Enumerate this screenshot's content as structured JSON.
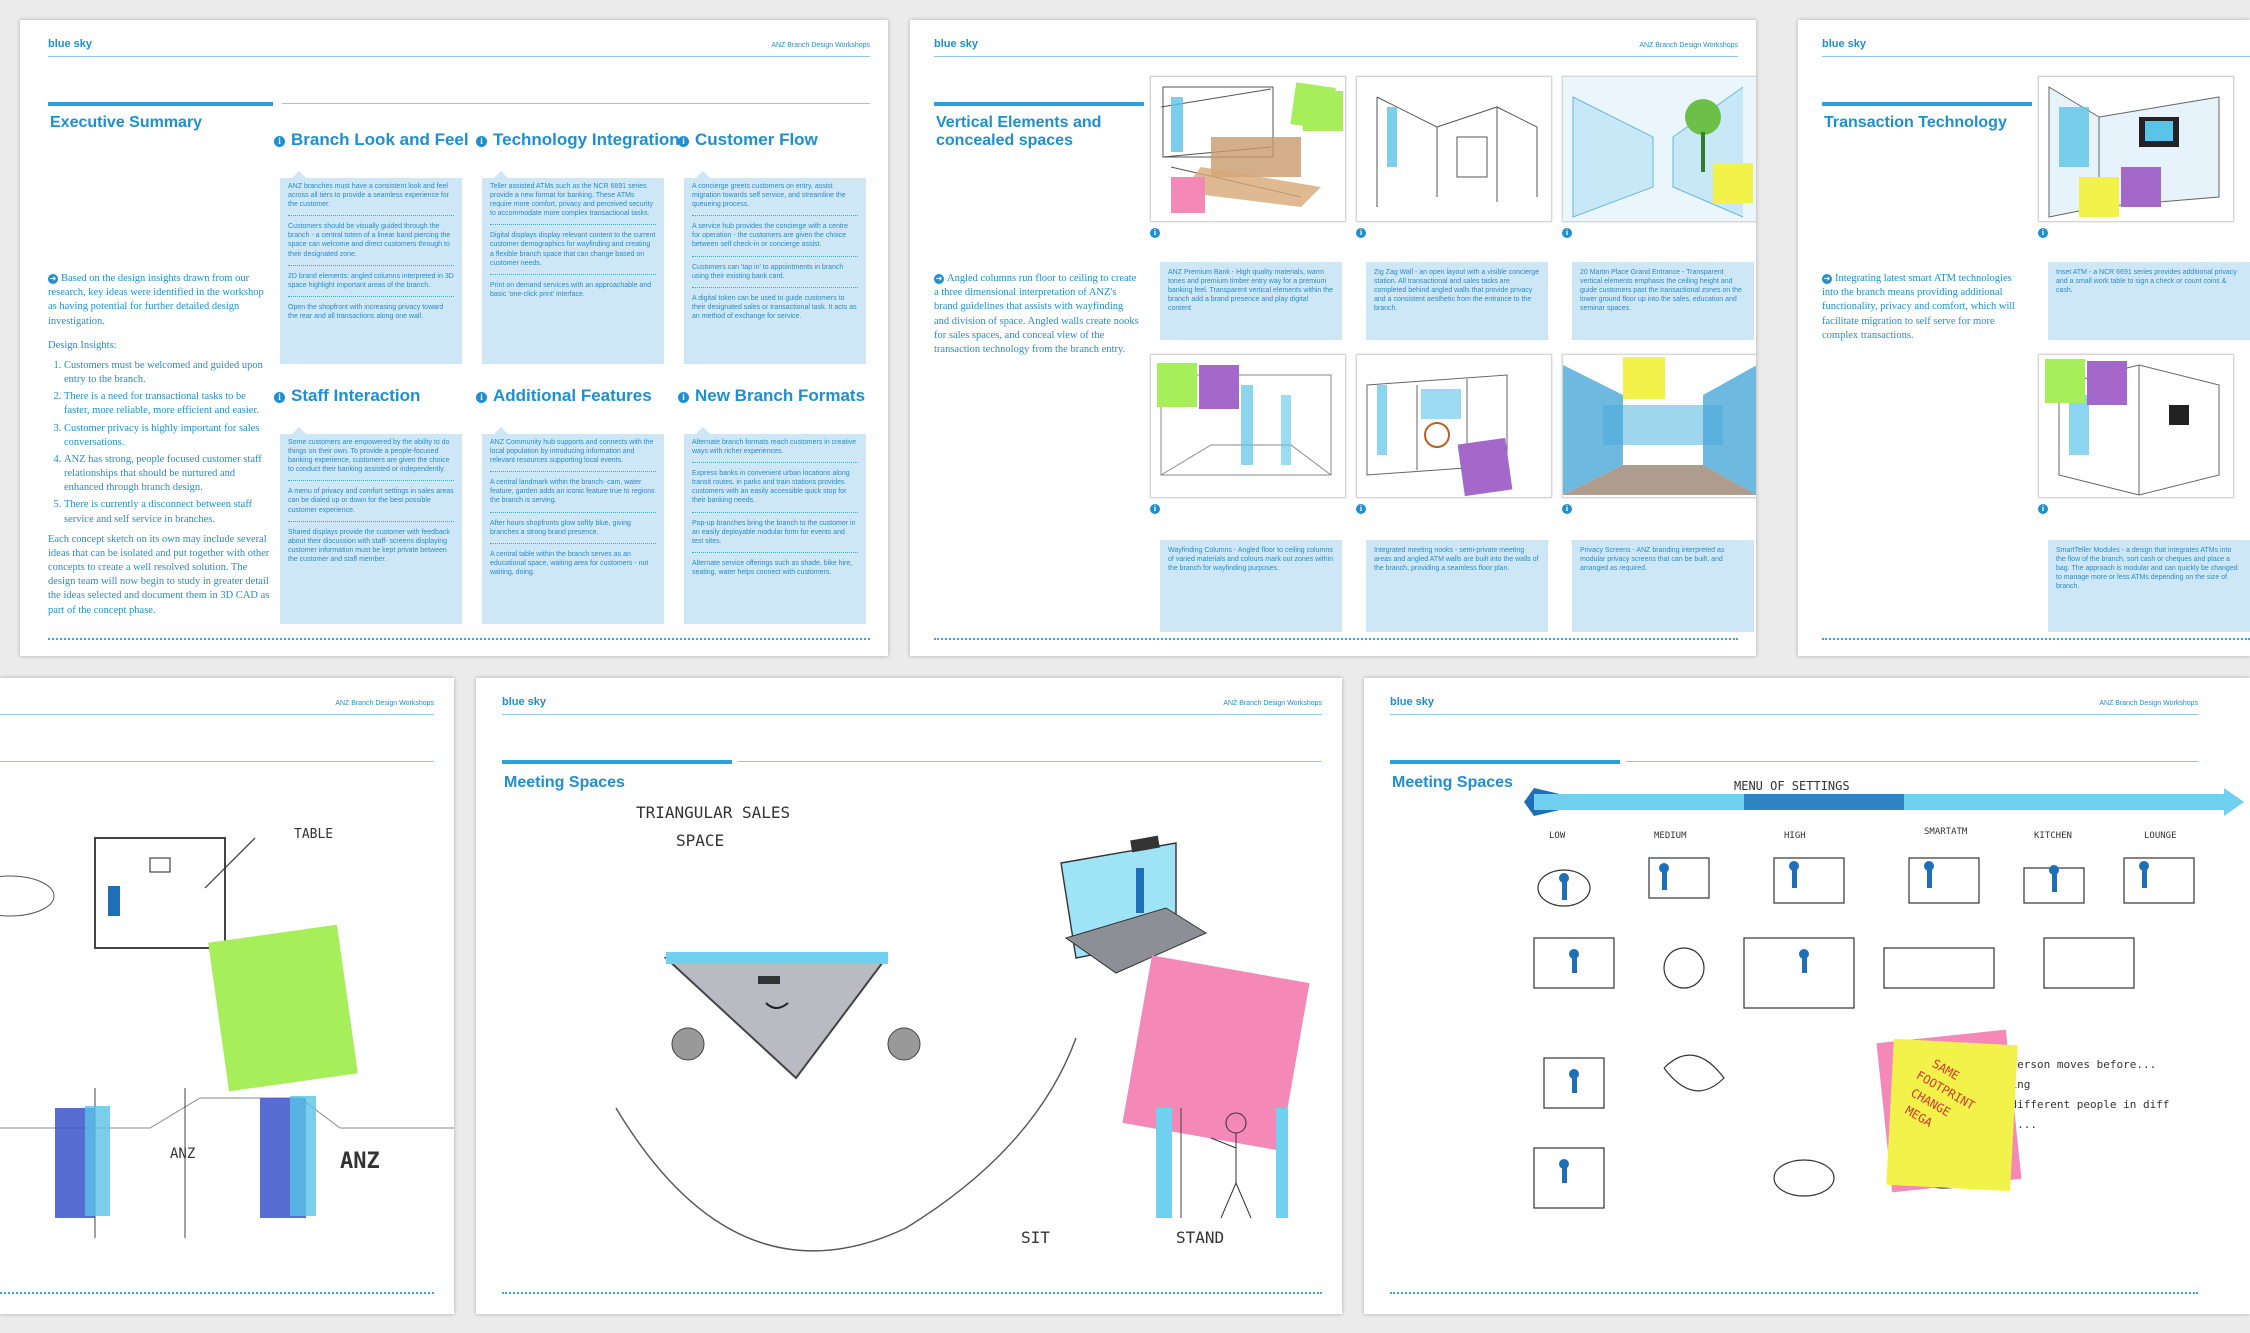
{
  "brand": "blue sky",
  "header_right": "ANZ Branch Design Workshops",
  "exec": {
    "title": "Executive Summary",
    "intro": "Based on the design insights drawn from our research, key ideas were identified in the workshop as having potential for further detailed design investigation.",
    "insights_label": "Design Insights:",
    "insights": [
      "Customers must be welcomed and guided upon entry to the branch.",
      "There is a need for transactional tasks to be faster, more reliable, more efficient and easier.",
      "Customer privacy is highly important for sales conversations.",
      "ANZ has strong, people focused customer staff relationships that should be nurtured and enhanced through branch design.",
      "There is currently a disconnect between staff service and self service in branches."
    ],
    "closing": "Each concept sketch on its own may include several ideas that can be isolated and put together with other concepts to create a well resolved solution. The design team will now begin to study in greater detail the ideas selected and document them in 3D CAD as part of the concept phase.",
    "columns": [
      {
        "heading": "Branch Look and Feel",
        "paras": [
          "ANZ branches must have a consistent look and feel across all tiers to provide a seamless experience for the customer.",
          "Customers should be visually guided through the branch - a central totem of a linear band piercing the space can welcome and direct customers through to their designated zone.",
          "2D brand elements: angled columns interpreted in 3D space highlight important areas of the branch.",
          "Open the shopfront with increasing privacy toward the rear and all transactions along one wall."
        ]
      },
      {
        "heading": "Technology Integration",
        "paras": [
          "Teller assisted ATMs such as the NCR 6691 series provide a new format for banking. These ATMs require more comfort, privacy and perceived security to accommodate more complex transactional tasks.",
          "Digital displays display relevant content to the current customer demographics for wayfinding and creating a flexible branch space that can change based on customer needs.",
          "Print on demand services with an approachable and basic 'one-click print' interface."
        ]
      },
      {
        "heading": "Customer Flow",
        "paras": [
          "A concierge greets customers on entry, assist migration towards self service, and streamline the queueing process.",
          "A service hub provides the concierge with a centre for operation - the customers are given the choice between self check-in or concierge assist.",
          "Customers can 'tap in' to appointments in branch using their existing bank card.",
          "A digital token can be used to guide customers to their designated sales or transactional task. It acts as an method of exchange for service."
        ]
      },
      {
        "heading": "Staff Interaction",
        "paras": [
          "Some customers are empowered by the ability to do things on their own. To provide a people-focused banking experience, customers are given the choice to conduct their banking assisted or independently.",
          "A menu of privacy and comfort settings in sales areas can be dialed up or down for the best possible customer experience.",
          "Shared displays provide the customer with feedback about their discussion with staff- screens displaying customer information must be kept private between the customer and staff member."
        ]
      },
      {
        "heading": "Additional Features",
        "paras": [
          "ANZ Community hub supports and connects with the local population by introducing information and relevant resources supporting local events.",
          "A central landmark within the branch- cam, water feature, garden adds an iconic feature true to regions the branch is serving.",
          "After hours shopfronts glow softly blue, giving branches a strong brand presence.",
          "A central table within the branch serves as an educational space, waiting area for customers - not waiting, doing."
        ]
      },
      {
        "heading": "New Branch Formats",
        "paras": [
          "Alternate branch formats reach customers in creative ways with richer experiences.",
          "Express banks in convenient urban locations along transit routes, in parks and train stations provides customers with an easily accessible quick stop for their banking needs.",
          "Pop-up branches bring the branch to the customer in an easily deployable modular form for events and test sites.",
          "Alternate service offerings such as shade, bike hire, seating, water helps connect with customers."
        ]
      }
    ]
  },
  "vertical": {
    "title": "Vertical Elements and concealed spaces",
    "intro": "Angled columns run floor to ceiling to create a three dimensional interpretation of ANZ's brand guidelines that assists with wayfinding and division of space. Angled walls create nooks for sales spaces, and conceal view of the transaction technology from the branch entry.",
    "captions": [
      "ANZ Premium Bank - High quality materials, warm tones and premium timber entry way for a premium banking feel. Transparent vertical elements within the branch add a brand presence and play digital content.",
      "Zig Zag Wall - an open layout with a visible concierge station. All transactional and sales tasks are completed behind angled walls that provide privacy and a consistent aesthetic from the entrance to the branch.",
      "20 Martin Place Grand Entrance - Transparent vertical elements emphasis the ceiling height and guide customers past the transactional zones on the lower ground floor up into the sales, education and seminar spaces.",
      "Wayfinding Columns - Angled floor to ceiling columns of varied materials and colours mark out zones within the branch for wayfinding purposes.",
      "Integrated meeting nooks - semi-private meeting areas and angled ATM walls are built into the walls of the branch, providing a seamless floor plan.",
      "Privacy Screens - ANZ branding interpreted as modular privacy screens that can be built, and arranged as required."
    ]
  },
  "transaction": {
    "title": "Transaction Technology",
    "intro": "Integrating latest smart ATM technologies into the branch means providing additional functionality, privacy and comfort, which will facilitate migration to self serve for more complex transactions.",
    "captions": [
      "Inset ATM - a NCR 6691 series provides additional privacy and a small work table to sign a check or count coins & cash.",
      "SmartTeller Modules - a design that integrates ATMs into the flow of the branch, sort cash or cheques and place a bag. The approach is modular and can quickly be changed to manage more or less ATMs depending on the size of branch."
    ]
  },
  "meeting1": {
    "title": "Meeting Spaces",
    "sketch_labels": [
      "TRIANGULAR SALES",
      "SPACE",
      "SIT",
      "STAND"
    ]
  },
  "meeting2": {
    "title": "Meeting Spaces",
    "sketch_labels": [
      "MENU OF SETTINGS",
      "LOW",
      "MEDIUM",
      "HIGH",
      "SMARTATM",
      "KITCHEN",
      "LOUNGE"
    ],
    "notes": [
      "one person moves before...",
      "setting",
      "not different people in diff",
      "zones..."
    ],
    "sticky_text": [
      "SAME",
      "FOOTPRINT",
      "CHANGE",
      "MEGA"
    ]
  },
  "partial": {
    "sketch_labels": [
      "TABLE",
      "ANZ",
      "ANZ"
    ]
  },
  "colors": {
    "accent": "#1e8fd0",
    "panel": "#cde7f7",
    "sticky_green": "#a6ef5a",
    "sticky_pink": "#f489b8",
    "sticky_yellow": "#f2f24a",
    "sticky_purple": "#a368c9"
  }
}
